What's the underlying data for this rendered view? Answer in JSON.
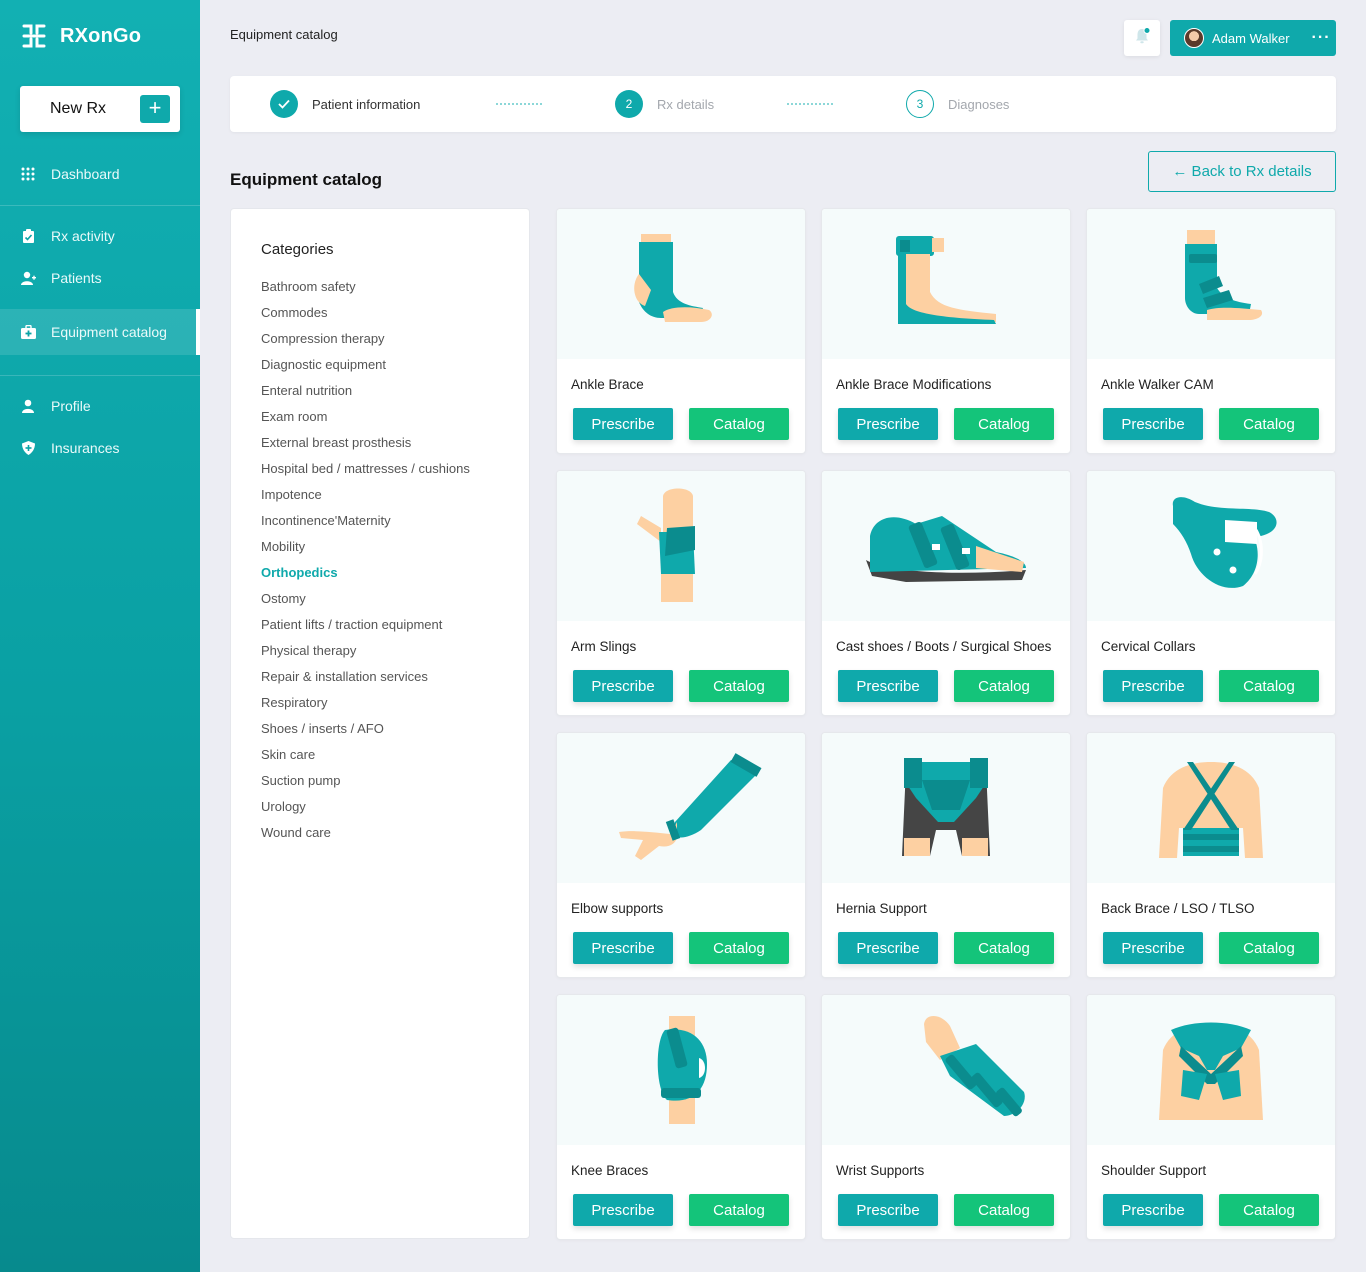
{
  "app": {
    "name": "RXonGo"
  },
  "sidebar": {
    "new_rx_label": "New Rx",
    "items": [
      {
        "label": "Dashboard",
        "icon": "grid-icon"
      },
      {
        "label": "Rx activity",
        "icon": "clipboard-icon"
      },
      {
        "label": "Patients",
        "icon": "user-plus-icon"
      },
      {
        "label": "Equipment catalog",
        "icon": "medkit-icon",
        "active": true
      },
      {
        "label": "Profile",
        "icon": "user-icon"
      },
      {
        "label": "Insurances",
        "icon": "shield-icon"
      }
    ]
  },
  "header": {
    "breadcrumb": "Equipment catalog",
    "user_name": "Adam Walker",
    "menu_glyph": "···"
  },
  "stepper": {
    "steps": [
      {
        "number": "",
        "label": "Patient information",
        "state": "done"
      },
      {
        "number": "2",
        "label": "Rx details",
        "state": "current"
      },
      {
        "number": "3",
        "label": "Diagnoses",
        "state": "todo"
      }
    ]
  },
  "main": {
    "title": "Equipment catalog",
    "back_label": "← Back to Rx details"
  },
  "categories": {
    "title": "Categories",
    "items": [
      "Bathroom safety",
      "Commodes",
      "Compression therapy",
      "Diagnostic equipment",
      "Enteral nutrition",
      "Exam room",
      "External breast prosthesis",
      "Hospital bed / mattresses / cushions",
      "Impotence",
      "Incontinence'Maternity",
      "Mobility",
      "Orthopedics",
      "Ostomy",
      "Patient lifts / traction equipment",
      "Physical therapy",
      "Repair & installation services",
      "Respiratory",
      "Shoes / inserts / AFO",
      "Skin care",
      "Suction pump",
      "Urology",
      "Wound care"
    ],
    "active": "Orthopedics"
  },
  "products": {
    "prescribe_label": "Prescribe",
    "catalog_label": "Catalog",
    "items": [
      {
        "name": "Ankle Brace",
        "icon": "ankle-brace-icon"
      },
      {
        "name": "Ankle Brace Modifications",
        "icon": "ankle-brace-mod-icon"
      },
      {
        "name": "Ankle Walker CAM",
        "icon": "ankle-walker-icon"
      },
      {
        "name": "Arm Slings",
        "icon": "arm-sling-icon"
      },
      {
        "name": "Cast shoes / Boots / Surgical Shoes",
        "icon": "cast-shoe-icon"
      },
      {
        "name": "Cervical Collars",
        "icon": "cervical-collar-icon"
      },
      {
        "name": "Elbow supports",
        "icon": "elbow-support-icon"
      },
      {
        "name": "Hernia Support",
        "icon": "hernia-support-icon"
      },
      {
        "name": "Back Brace / LSO / TLSO",
        "icon": "back-brace-icon"
      },
      {
        "name": "Knee Braces",
        "icon": "knee-brace-icon"
      },
      {
        "name": "Wrist Supports",
        "icon": "wrist-support-icon"
      },
      {
        "name": "Shoulder Support",
        "icon": "shoulder-support-icon"
      }
    ]
  },
  "colors": {
    "accent": "#0fa9ab",
    "catalog_green": "#14c47a",
    "skin": "#fdd0a2",
    "dark_teal": "#0b8c8e"
  }
}
